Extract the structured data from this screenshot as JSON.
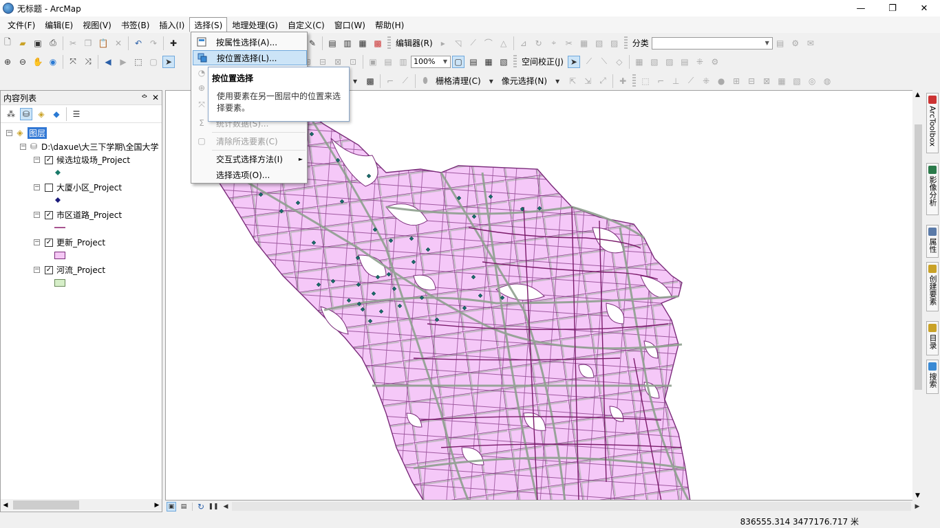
{
  "window": {
    "title": "无标题 - ArcMap",
    "min": "—",
    "max": "❐",
    "close": "✕"
  },
  "menu": [
    "文件(F)",
    "编辑(E)",
    "视图(V)",
    "书签(B)",
    "插入(I)",
    "选择(S)",
    "地理处理(G)",
    "自定义(C)",
    "窗口(W)",
    "帮助(H)"
  ],
  "toolbar": {
    "editor_label": "编辑器(R)",
    "classify_label": "分类",
    "scale_value": "100%",
    "spatial_adjust_label": "空间校正(J)",
    "grid_clean_label": "栅格清理(C)",
    "pixel_select_label": "像元选择(N)"
  },
  "select_menu": {
    "items": [
      {
        "label": "按属性选择(A)...",
        "state": "normal"
      },
      {
        "label": "按位置选择(L)...",
        "state": "selected"
      },
      {
        "label": "统计数据(S)...",
        "state": "disabled"
      },
      {
        "label": "清除所选要素(C)",
        "state": "disabled"
      },
      {
        "label": "交互式选择方法(I)",
        "state": "normal",
        "submenu": "►"
      },
      {
        "label": "选择选项(O)...",
        "state": "normal"
      }
    ]
  },
  "tooltip": {
    "title": "按位置选择",
    "body": "使用要素在另一图层中的位置来选择要素。"
  },
  "toc": {
    "title": "内容列表",
    "pin": "ᅌ",
    "close": "✕",
    "root": "图层",
    "datasource": "D:\\daxue\\大三下学期\\全国大学",
    "layers": [
      {
        "name": "候选垃圾场_Project",
        "checked": true,
        "symbol": "point",
        "color": "#1a7a6a"
      },
      {
        "name": "大厦小区_Project",
        "checked": false,
        "symbol": "point",
        "color": "#1a1a7a"
      },
      {
        "name": "市区道路_Project",
        "checked": true,
        "symbol": "line",
        "color": "#8a1a6a"
      },
      {
        "name": "更新_Project",
        "checked": true,
        "symbol": "poly",
        "color": "#f5c8f5"
      },
      {
        "name": "河流_Project",
        "checked": true,
        "symbol": "poly",
        "color": "#d6eec8"
      }
    ]
  },
  "right_tabs": [
    "ArcToolbox",
    "影像分析",
    "属性",
    "创建要素",
    "目录",
    "搜索"
  ],
  "status": {
    "coords": "836555.314  3477176.717 米"
  },
  "colors": {
    "district_fill": "#f5c8f8",
    "district_stroke": "#7a2a7a",
    "road": "#8fa08f",
    "point": "#1a6a6a"
  }
}
